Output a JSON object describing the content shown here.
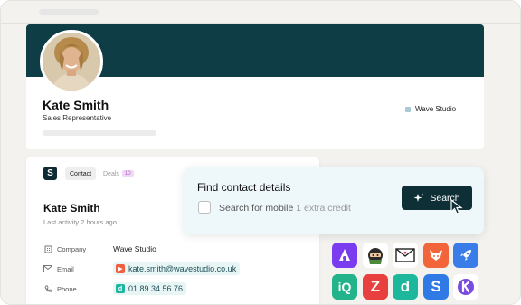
{
  "profile": {
    "name": "Kate Smith",
    "title": "Sales Representative",
    "company": "Wave Studio"
  },
  "tabs": {
    "contact": "Contact",
    "deals": "Deals",
    "deals_count": "10"
  },
  "contact": {
    "name": "Kate Smith",
    "last_activity": "Last activity 2 hours ago",
    "rows": {
      "company": {
        "label": "Company",
        "value": "Wave Studio"
      },
      "email": {
        "label": "Email",
        "value": "kate.smith@wavestudio.co.uk"
      },
      "phone": {
        "label": "Phone",
        "value": "01 89 34 56 76"
      }
    }
  },
  "find_contact": {
    "title": "Find contact details",
    "option_label": "Search for mobile",
    "option_note": "1 extra credit",
    "button_label": "Search"
  },
  "colors": {
    "banner": "#0f3d45",
    "primary_button": "#0f2f36",
    "chip_background": "#e7f5f5",
    "deals_badge": "#efd9f5"
  },
  "integrations": [
    "app-purple-icon",
    "ninja-icon",
    "mail-heart-icon",
    "fox-icon",
    "rocket-icon",
    "iq-icon",
    "z-icon",
    "d-icon",
    "s-icon",
    "k-icon"
  ]
}
